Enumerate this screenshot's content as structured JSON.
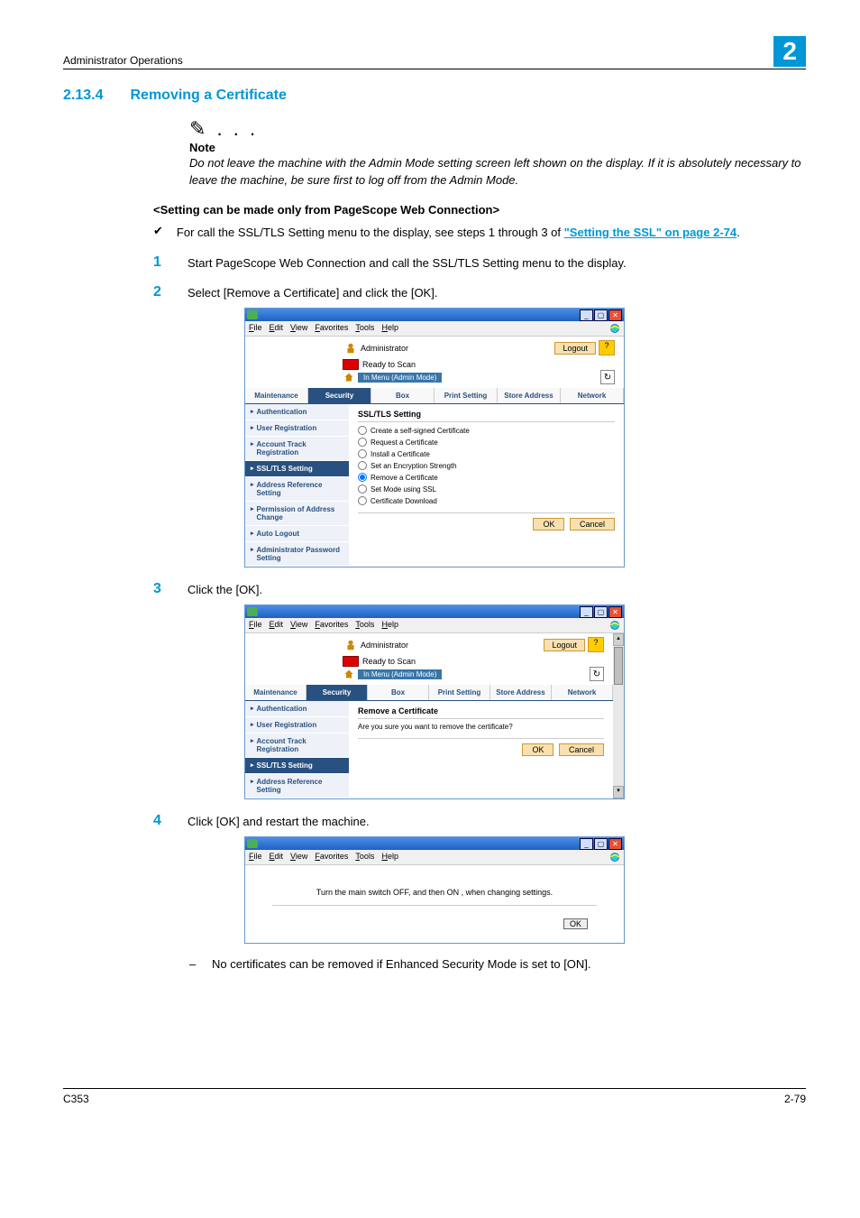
{
  "header": {
    "title": "Administrator Operations",
    "chapter": "2"
  },
  "section": {
    "number": "2.13.4",
    "title": "Removing a Certificate"
  },
  "note": {
    "icon": "✎ . . .",
    "label": "Note",
    "text": "Do not leave the machine with the Admin Mode setting screen left shown on the display. If it is absolutely necessary to leave the machine, be sure first to log off from the Admin Mode."
  },
  "setting_head": "<Setting can be made only from PageScope Web Connection>",
  "prereq": {
    "mark": "✔",
    "text_a": "For call the SSL/TLS Setting menu to the display, see steps 1 through 3 of ",
    "link": "\"Setting the SSL\" on page 2-74",
    "text_b": "."
  },
  "steps": [
    {
      "num": "1",
      "text": "Start PageScope Web Connection and call the SSL/TLS Setting menu to the display."
    },
    {
      "num": "2",
      "text": "Select [Remove a Certificate] and click the [OK]."
    },
    {
      "num": "3",
      "text": "Click the [OK]."
    },
    {
      "num": "4",
      "text": "Click [OK] and restart the machine."
    }
  ],
  "substep": {
    "dash": "–",
    "text": "No certificates can be removed if Enhanced Security Mode is set to [ON]."
  },
  "footer": {
    "left": "C353",
    "right": "2-79"
  },
  "browser_common": {
    "menus": [
      "File",
      "Edit",
      "View",
      "Favorites",
      "Tools",
      "Help"
    ],
    "admin": "Administrator",
    "logout": "Logout",
    "help": "?",
    "status": "Ready to Scan",
    "mode": "In Menu (Admin Mode)",
    "tabs": [
      "Maintenance",
      "Security",
      "Box",
      "Print Setting",
      "Store Address",
      "Network"
    ],
    "sidebar_full": [
      "Authentication",
      "User Registration",
      "Account Track Registration",
      "SSL/TLS Setting",
      "Address Reference Setting",
      "Permission of Address Change",
      "Auto Logout",
      "Administrator Password Setting"
    ],
    "ok": "OK",
    "cancel": "Cancel"
  },
  "panel1": {
    "title": "SSL/TLS Setting",
    "options": [
      "Create a self-signed Certificate",
      "Request a Certificate",
      "Install a Certificate",
      "Set an Encryption Strength",
      "Remove a Certificate",
      "Set Mode using SSL",
      "Certificate Download"
    ],
    "selected": "Remove a Certificate"
  },
  "panel2": {
    "title": "Remove a Certificate",
    "msg": "Are you sure you want to remove the certificate?",
    "sidebar_short": [
      "Authentication",
      "User Registration",
      "Account Track Registration",
      "SSL/TLS Setting",
      "Address Reference Setting"
    ]
  },
  "panel3": {
    "msg": "Turn the main switch OFF, and then ON , when changing settings.",
    "ok": "OK"
  }
}
